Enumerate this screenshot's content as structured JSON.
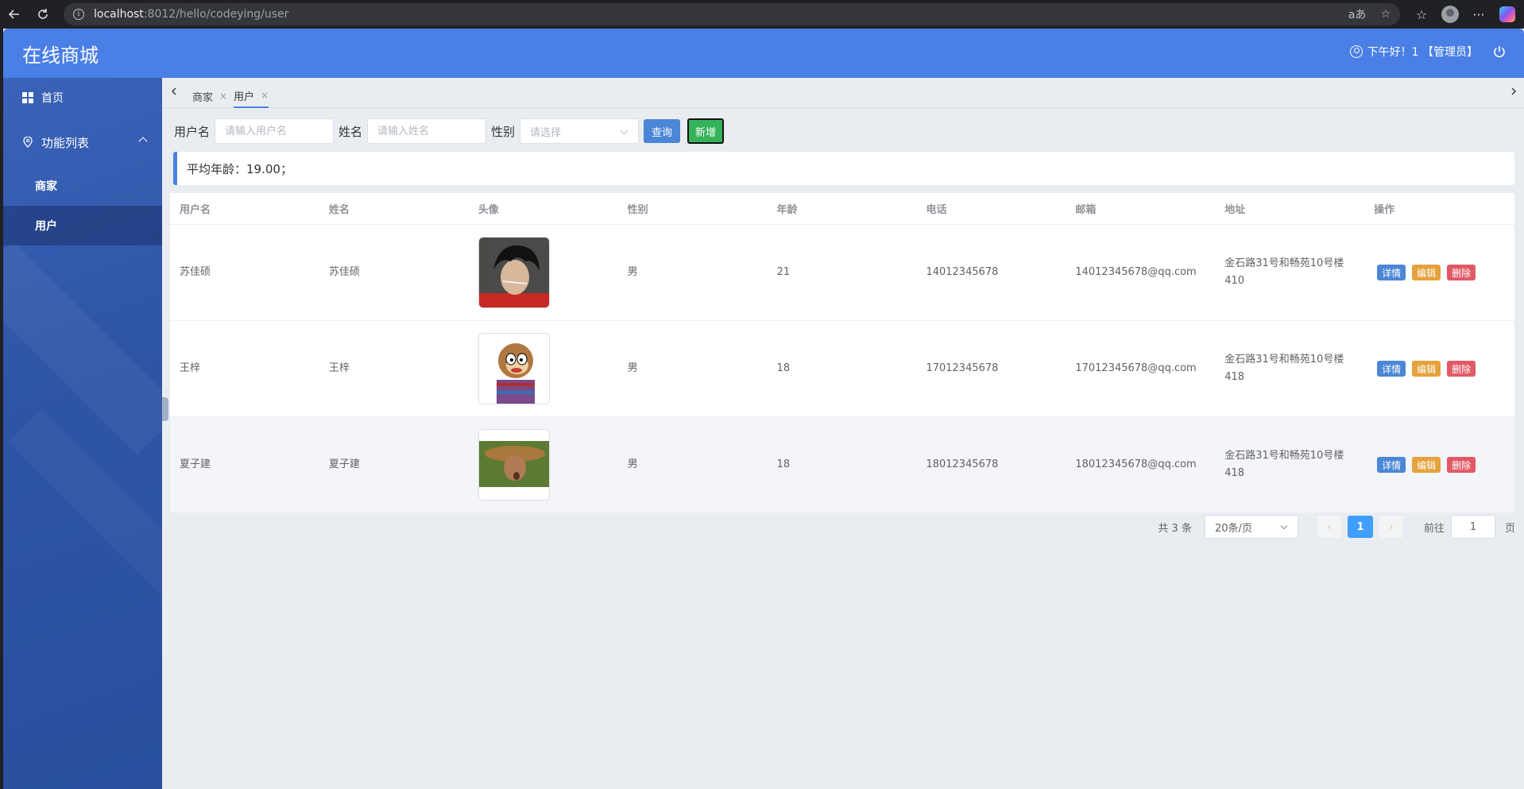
{
  "browser": {
    "url_host": "localhost",
    "url_path": ":8012/hello/codeying/user",
    "read_aloud_icon": "aあ"
  },
  "app": {
    "logo": "在线商城",
    "greeting": "下午好！1 【管理员】"
  },
  "sidebar": {
    "items": [
      {
        "label": "首页",
        "icon": "grid-icon"
      },
      {
        "label": "功能列表",
        "icon": "location-icon"
      },
      {
        "label": "商家"
      },
      {
        "label": "用户"
      }
    ]
  },
  "tabs": [
    {
      "label": "商家",
      "close": "×"
    },
    {
      "label": "用户",
      "close": "×"
    }
  ],
  "search": {
    "username_label": "用户名",
    "username_placeholder": "请输入用户名",
    "name_label": "姓名",
    "name_placeholder": "请输入姓名",
    "gender_label": "性别",
    "gender_placeholder": "请选择",
    "query_button": "查询",
    "add_button": "新增"
  },
  "summary": {
    "avg_age_text": "平均年龄：19.00；"
  },
  "table": {
    "headers": [
      "用户名",
      "姓名",
      "头像",
      "性别",
      "年龄",
      "电话",
      "邮箱",
      "地址",
      "操作"
    ],
    "rows": [
      {
        "username": "苏佳硕",
        "name": "苏佳硕",
        "gender": "男",
        "age": "21",
        "phone": "14012345678",
        "email": "14012345678@qq.com",
        "address_line1": "金石路31号和畅苑10号楼",
        "address_line2": "410"
      },
      {
        "username": "王梓",
        "name": "王梓",
        "gender": "男",
        "age": "18",
        "phone": "17012345678",
        "email": "17012345678@qq.com",
        "address_line1": "金石路31号和畅苑10号楼",
        "address_line2": "418"
      },
      {
        "username": "夏子建",
        "name": "夏子建",
        "gender": "男",
        "age": "18",
        "phone": "18012345678",
        "email": "18012345678@qq.com",
        "address_line1": "金石路31号和畅苑10号楼",
        "address_line2": "418"
      }
    ],
    "actions": {
      "detail": "详情",
      "edit": "编辑",
      "delete": "删除"
    }
  },
  "pagination": {
    "total": "共 3 条",
    "page_size": "20条/页",
    "current_page": "1",
    "goto_label": "前往",
    "goto_value": "1",
    "page_suffix": "页"
  },
  "colors": {
    "header": "#4a7fe6",
    "sidebar": "#2f55a7",
    "query_button": "#4b87d6",
    "add_button": "#35b35a",
    "detail_button": "#4b87d6",
    "edit_button": "#e6a23c",
    "delete_button": "#e05a66",
    "active_page": "#409eff"
  }
}
